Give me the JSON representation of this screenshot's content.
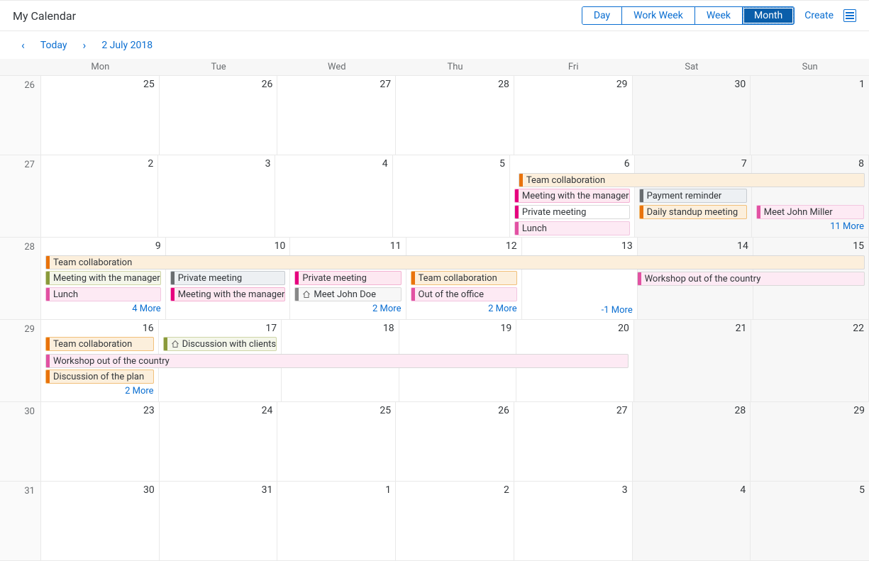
{
  "title": "My Calendar",
  "views": {
    "day": "Day",
    "workweek": "Work Week",
    "week": "Week",
    "month": "Month",
    "active": "Month"
  },
  "create": "Create",
  "nav": {
    "today": "Today",
    "date": "2 July 2018"
  },
  "daynames": [
    "Mon",
    "Tue",
    "Wed",
    "Thu",
    "Fri",
    "Sat",
    "Sun"
  ],
  "weeks": [
    {
      "num": "26",
      "days": [
        "25",
        "26",
        "27",
        "28",
        "29",
        "30",
        "1"
      ],
      "weekend": [
        5,
        6
      ]
    },
    {
      "num": "27",
      "days": [
        "2",
        "3",
        "4",
        "5",
        "6",
        "7",
        "8"
      ],
      "weekend": [
        5,
        6
      ]
    },
    {
      "num": "28",
      "days": [
        "9",
        "10",
        "11",
        "12",
        "13",
        "14",
        "15"
      ],
      "weekend": [
        5,
        6
      ]
    },
    {
      "num": "29",
      "days": [
        "16",
        "17",
        "18",
        "19",
        "20",
        "21",
        "22"
      ],
      "weekend": [
        5,
        6
      ]
    },
    {
      "num": "30",
      "days": [
        "23",
        "24",
        "25",
        "26",
        "27",
        "28",
        "29"
      ],
      "weekend": [
        5,
        6
      ]
    },
    {
      "num": "31",
      "days": [
        "30",
        "31",
        "1",
        "2",
        "3",
        "4",
        "5"
      ],
      "weekend": [
        5,
        6
      ]
    }
  ],
  "events": {
    "w27": {
      "team_collab": "Team collaboration",
      "mtg_manager": "Meeting with the manager",
      "payment": "Payment reminder",
      "private": "Private meeting",
      "standup": "Daily standup meeting",
      "meet_miller": "Meet John Miller",
      "lunch": "Lunch",
      "more": "11 More"
    },
    "w28": {
      "team_collab": "Team collaboration",
      "mtg_manager": "Meeting with the manager",
      "private": "Private meeting",
      "private2": "Private meeting",
      "team_collab2": "Team collaboration",
      "workshop": "Workshop out of the country",
      "lunch": "Lunch",
      "mtg_manager2": "Meeting with the manager",
      "meet_doe": "Meet John Doe",
      "out_office": "Out of the office",
      "more_mon": "4 More",
      "more_wed": "2 More",
      "more_thu": "2 More",
      "more_fri": "-1 More"
    },
    "w29": {
      "team_collab": "Team collaboration",
      "discuss_clients": "Discussion with clients",
      "workshop": "Workshop out of the country",
      "discuss_plan": "Discussion of the plan",
      "more": "2 More"
    }
  }
}
